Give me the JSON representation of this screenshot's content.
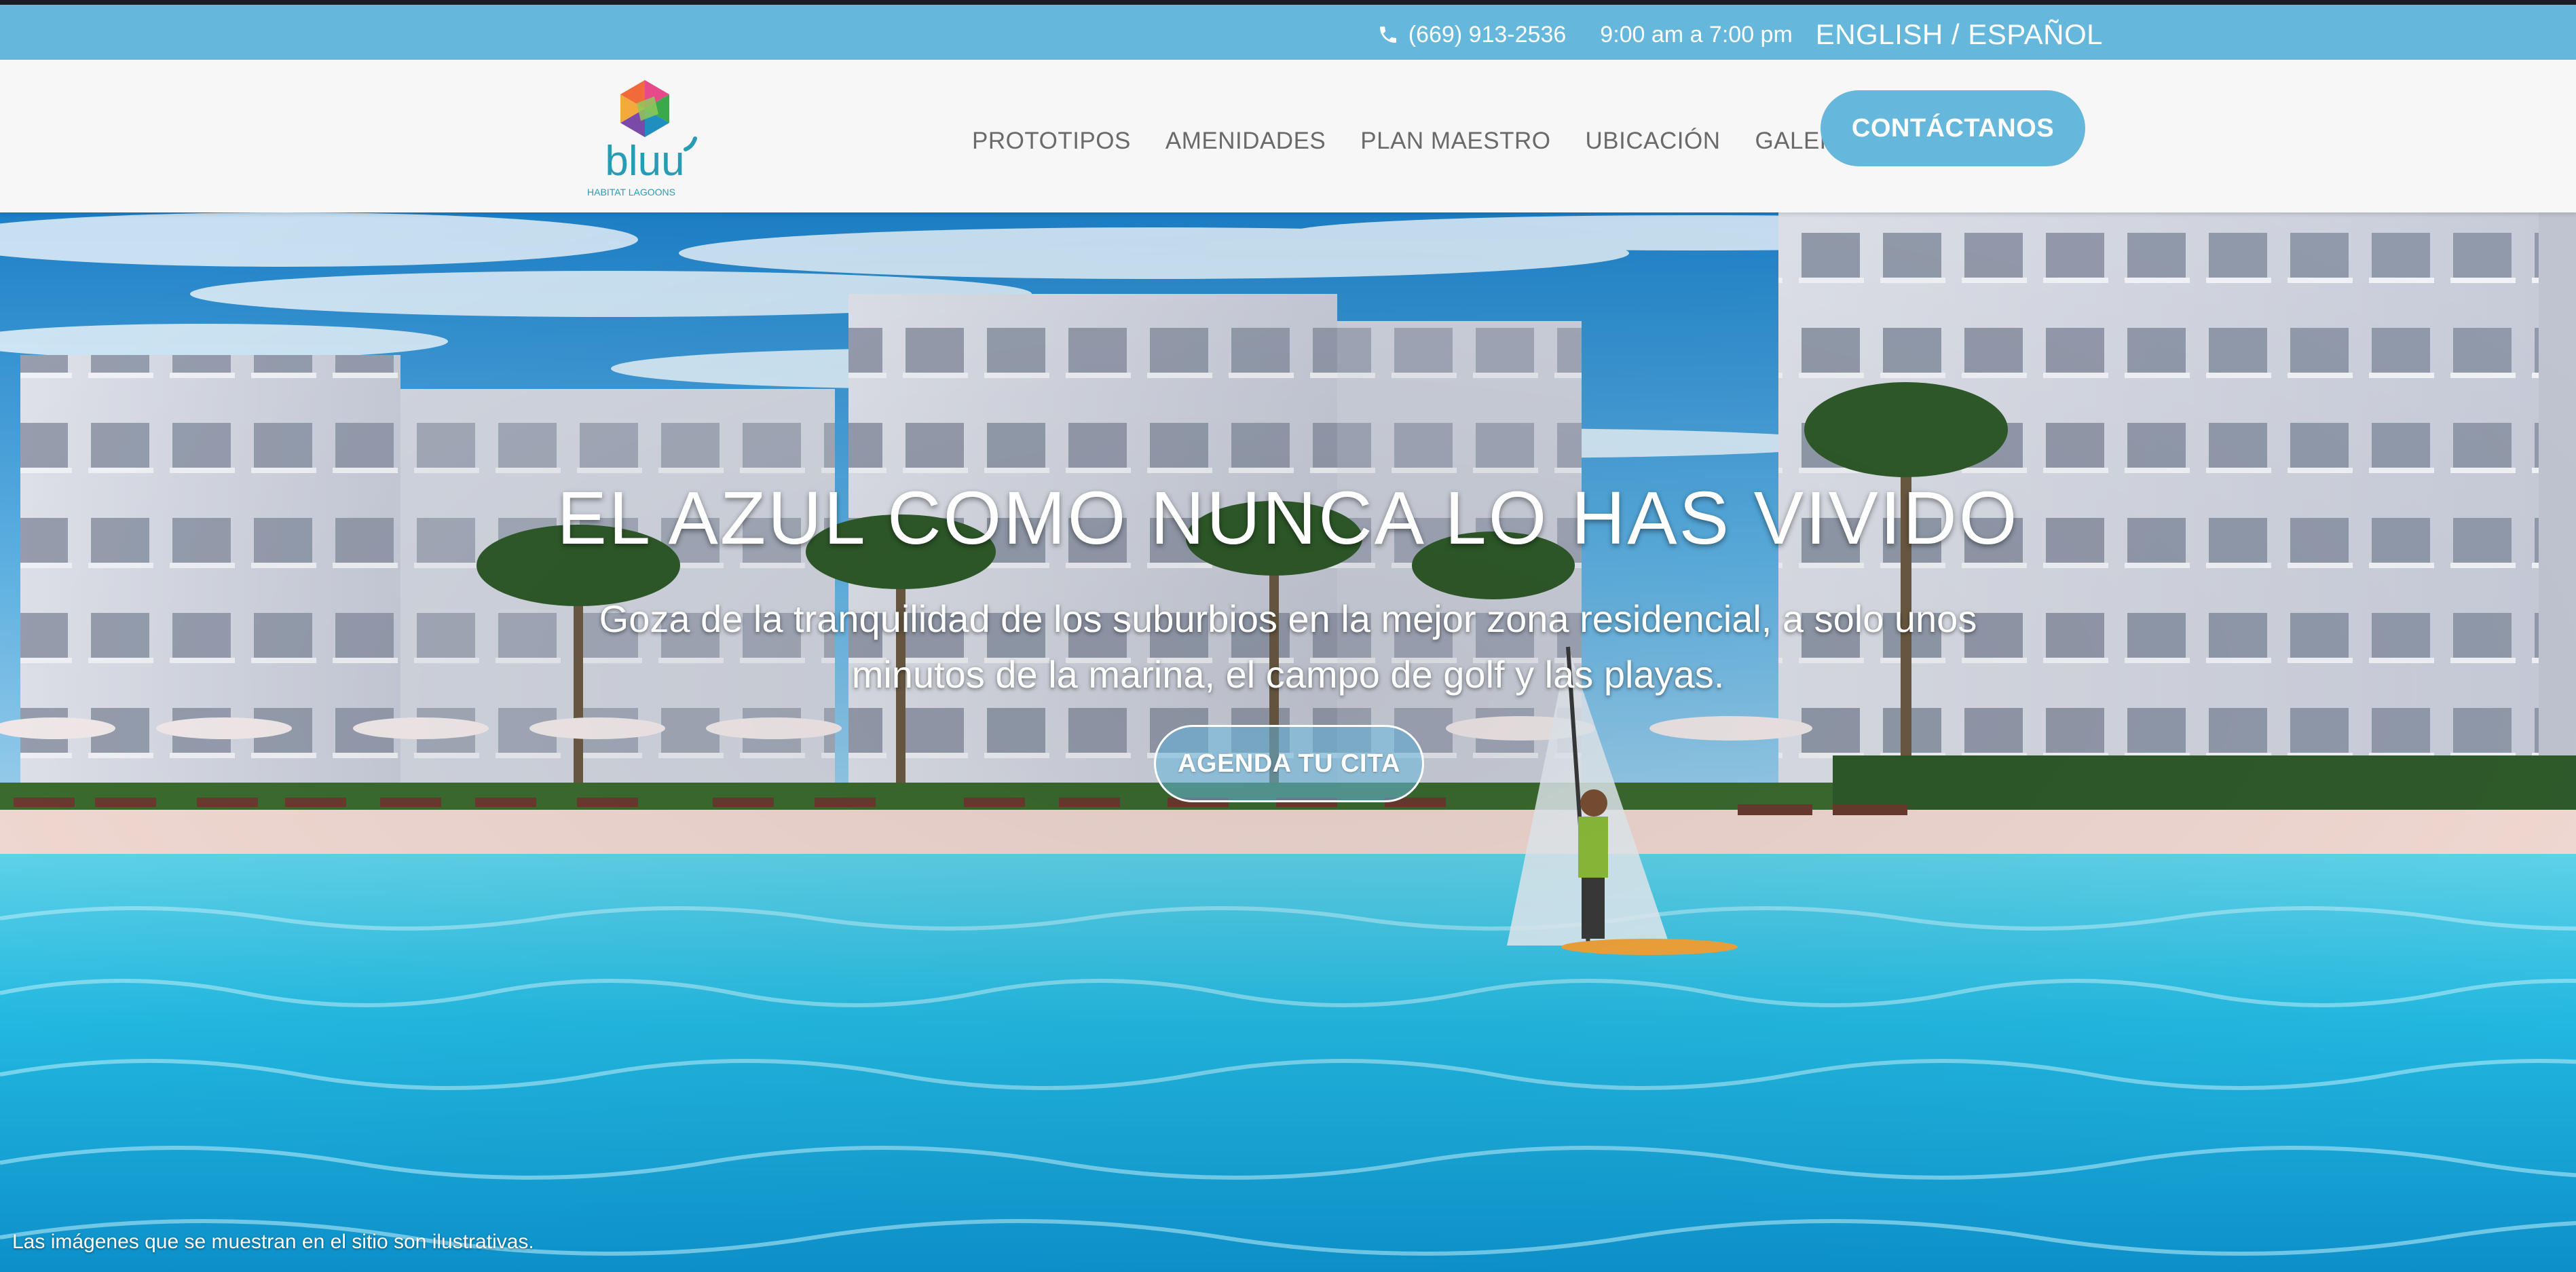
{
  "topbar": {
    "phone": "(669) 913-2536",
    "hours": "9:00 am a 7:00 pm",
    "lang_english": "ENGLISH",
    "lang_separator": " / ",
    "lang_spanish": "ESPAÑOL",
    "icons": {
      "phone": "phone-icon"
    }
  },
  "header": {
    "logo_text": "bluu",
    "logo_tagline": "HABITAT LAGOONS",
    "nav": [
      "PROTOTIPOS",
      "AMENIDADES",
      "PLAN MAESTRO",
      "UBICACIÓN",
      "GALERÍA"
    ],
    "cta_label": "CONTÁCTANOS"
  },
  "hero": {
    "title": "EL AZUL COMO NUNCA LO HAS VIVIDO",
    "subtitle": "Goza de la tranquilidad de los suburbios en la mejor zona residencial, a solo unos minutos de la marina, el campo de golf y las playas.",
    "button_label": "AGENDA TU CITA",
    "disclaimer": "Las imágenes que se muestran en el sitio son ilustrativas."
  },
  "colors": {
    "accent": "#66b7dc",
    "header_bg": "#f7f7f8",
    "nav_text": "#6a6a6a",
    "logo_teal": "#2a9bb5"
  }
}
